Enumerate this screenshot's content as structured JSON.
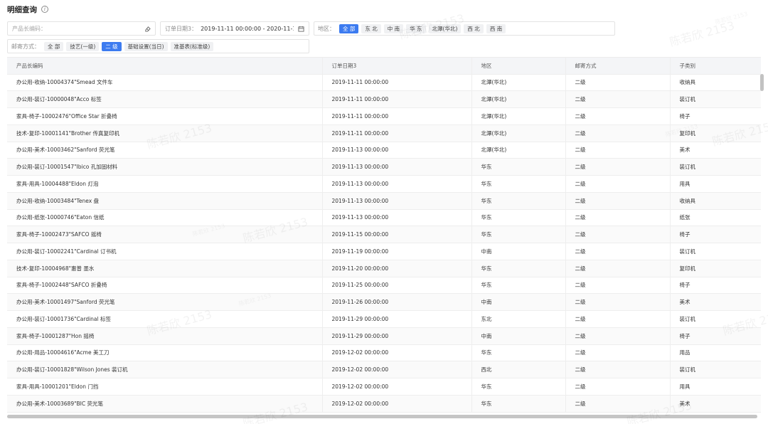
{
  "title": "明细查询",
  "info_icon": "info-circle-icon",
  "filters": {
    "product_placeholder": "产品长编码：",
    "product_value": "",
    "date_label": "订单日期3：",
    "date_value": "2019-11-11 00:00:00 - 2020-11-1...",
    "region_label": "地区：",
    "region_options": [
      "全 部",
      "东 北",
      "中 南",
      "华 东",
      "北潭(华北)",
      "西 北",
      "西 南"
    ],
    "region_selected": "全 部",
    "ship_label": "邮寄方式：",
    "ship_options": [
      "全 部",
      "技艺(一级)",
      "二 级",
      "基础设置(当日)",
      "准基表(标准级)"
    ],
    "ship_selected": "二 级"
  },
  "table": {
    "columns": [
      "产品长编码",
      "订单日期3",
      "地区",
      "邮寄方式",
      "子类别"
    ],
    "rows": [
      [
        "办公用-收纳-10004374\"Smead 文件车",
        "2019-11-11 00:00:00",
        "北潭(华北)",
        "二级",
        "收纳具"
      ],
      [
        "办公用-装订-10000048\"Acco 标签",
        "2019-11-11 00:00:00",
        "北潭(华北)",
        "二级",
        "装订机"
      ],
      [
        "家具-椅子-10002476\"Office Star 折叠椅",
        "2019-11-11 00:00:00",
        "北潭(华北)",
        "二级",
        "椅子"
      ],
      [
        "技术-复印-10001141\"Brother 传真复印机",
        "2019-11-11 00:00:00",
        "北潭(华北)",
        "二级",
        "复印机"
      ],
      [
        "办公用-美术-10003462\"Sanford 荧光笔",
        "2019-11-13 00:00:00",
        "北潭(华北)",
        "二级",
        "美术"
      ],
      [
        "办公用-装订-10001547\"Ibico 孔加固材料",
        "2019-11-13 00:00:00",
        "华东",
        "二级",
        "装订机"
      ],
      [
        "家具-用具-10004488\"Eldon 灯泡",
        "2019-11-13 00:00:00",
        "华东",
        "二级",
        "用具"
      ],
      [
        "办公用-收纳-10003484\"Tenex 盘",
        "2019-11-13 00:00:00",
        "华东",
        "二级",
        "收纳具"
      ],
      [
        "办公用-纸张-10000746\"Eaton 信纸",
        "2019-11-13 00:00:00",
        "华东",
        "二级",
        "纸张"
      ],
      [
        "家具-椅子-10002473\"SAFCO 摇椅",
        "2019-11-15 00:00:00",
        "华东",
        "二级",
        "椅子"
      ],
      [
        "办公用-装订-10002241\"Cardinal 订书机",
        "2019-11-19 00:00:00",
        "中南",
        "二级",
        "装订机"
      ],
      [
        "技术-复印-10004968\"惠普 墨水",
        "2019-11-20 00:00:00",
        "华东",
        "二级",
        "复印机"
      ],
      [
        "家具-椅子-10002448\"SAFCO 折叠椅",
        "2019-11-25 00:00:00",
        "华东",
        "二级",
        "椅子"
      ],
      [
        "办公用-美术-10001497\"Sanford 荧光笔",
        "2019-11-26 00:00:00",
        "中南",
        "二级",
        "美术"
      ],
      [
        "办公用-装订-10001736\"Cardinal 标签",
        "2019-11-29 00:00:00",
        "东北",
        "二级",
        "装订机"
      ],
      [
        "家具-椅子-10001287\"Hon 摇椅",
        "2019-11-29 00:00:00",
        "中南",
        "二级",
        "椅子"
      ],
      [
        "办公用-用品-10004616\"Acme 美工刀",
        "2019-12-02 00:00:00",
        "华东",
        "二级",
        "用品"
      ],
      [
        "办公用-装订-10001828\"Wilson Jones 装订机",
        "2019-12-02 00:00:00",
        "西北",
        "二级",
        "装订机"
      ],
      [
        "家具-用具-10001201\"Eldon 门挡",
        "2019-12-02 00:00:00",
        "华东",
        "二级",
        "用具"
      ],
      [
        "办公用-美术-10003689\"BIC 荧光笔",
        "2019-12-02 00:00:00",
        "华东",
        "二级",
        "美术"
      ]
    ]
  },
  "watermark": {
    "text": "陈若欣 2153",
    "small_text": "陈若欣 2153"
  },
  "colors": {
    "accent": "#3c7bf0",
    "chip_bg": "#f0f1f3",
    "header_bg": "#f4f5f7"
  }
}
